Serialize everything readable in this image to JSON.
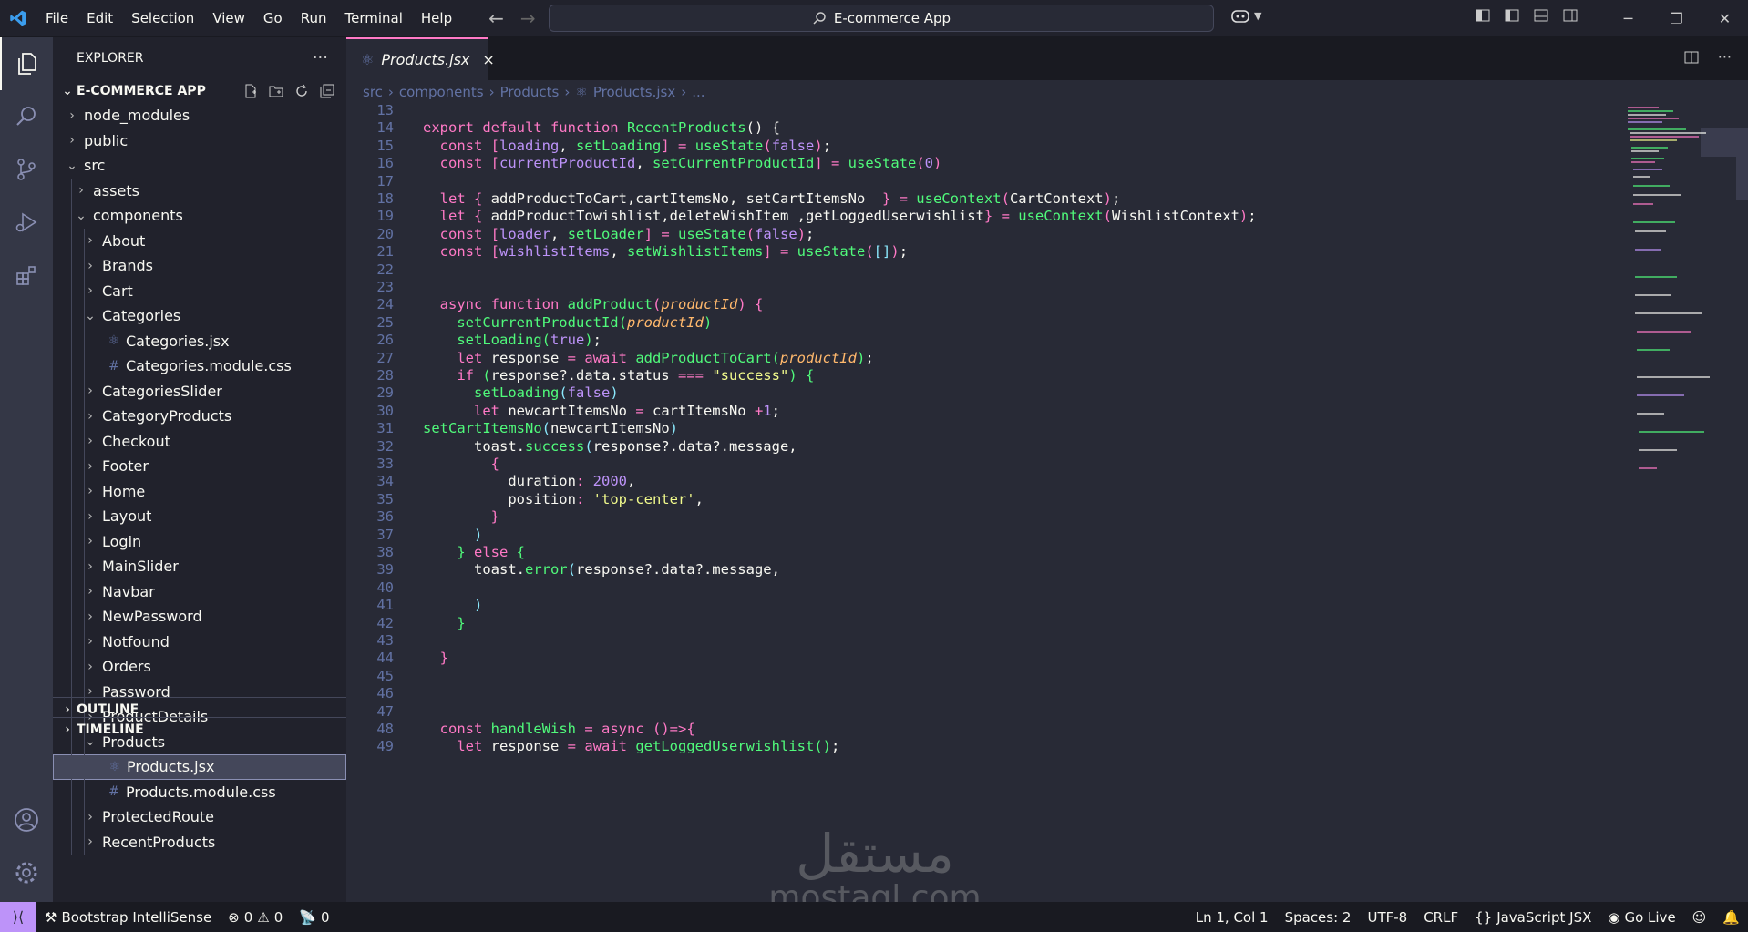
{
  "menu": [
    "File",
    "Edit",
    "Selection",
    "View",
    "Go",
    "Run",
    "Terminal",
    "Help"
  ],
  "command_center": "E-commerce App",
  "explorer": {
    "title": "EXPLORER",
    "root": "E-COMMERCE APP",
    "tree": [
      {
        "label": "node_modules",
        "type": "folder",
        "expanded": false,
        "depth": 0
      },
      {
        "label": "public",
        "type": "folder",
        "expanded": false,
        "depth": 0
      },
      {
        "label": "src",
        "type": "folder",
        "expanded": true,
        "depth": 0
      },
      {
        "label": "assets",
        "type": "folder",
        "expanded": false,
        "depth": 1
      },
      {
        "label": "components",
        "type": "folder",
        "expanded": true,
        "depth": 1
      },
      {
        "label": "About",
        "type": "folder",
        "expanded": false,
        "depth": 2
      },
      {
        "label": "Brands",
        "type": "folder",
        "expanded": false,
        "depth": 2
      },
      {
        "label": "Cart",
        "type": "folder",
        "expanded": false,
        "depth": 2
      },
      {
        "label": "Categories",
        "type": "folder",
        "expanded": true,
        "depth": 2
      },
      {
        "label": "Categories.jsx",
        "type": "jsx",
        "depth": 3
      },
      {
        "label": "Categories.module.css",
        "type": "css",
        "depth": 3
      },
      {
        "label": "CategoriesSlider",
        "type": "folder",
        "expanded": false,
        "depth": 2
      },
      {
        "label": "CategoryProducts",
        "type": "folder",
        "expanded": false,
        "depth": 2
      },
      {
        "label": "Checkout",
        "type": "folder",
        "expanded": false,
        "depth": 2
      },
      {
        "label": "Footer",
        "type": "folder",
        "expanded": false,
        "depth": 2
      },
      {
        "label": "Home",
        "type": "folder",
        "expanded": false,
        "depth": 2
      },
      {
        "label": "Layout",
        "type": "folder",
        "expanded": false,
        "depth": 2
      },
      {
        "label": "Login",
        "type": "folder",
        "expanded": false,
        "depth": 2
      },
      {
        "label": "MainSlider",
        "type": "folder",
        "expanded": false,
        "depth": 2
      },
      {
        "label": "Navbar",
        "type": "folder",
        "expanded": false,
        "depth": 2
      },
      {
        "label": "NewPassword",
        "type": "folder",
        "expanded": false,
        "depth": 2
      },
      {
        "label": "Notfound",
        "type": "folder",
        "expanded": false,
        "depth": 2
      },
      {
        "label": "Orders",
        "type": "folder",
        "expanded": false,
        "depth": 2
      },
      {
        "label": "Password",
        "type": "folder",
        "expanded": false,
        "depth": 2
      },
      {
        "label": "ProductDetails",
        "type": "folder",
        "expanded": false,
        "depth": 2
      },
      {
        "label": "Products",
        "type": "folder",
        "expanded": true,
        "depth": 2
      },
      {
        "label": "Products.jsx",
        "type": "jsx",
        "depth": 3,
        "selected": true
      },
      {
        "label": "Products.module.css",
        "type": "css",
        "depth": 3
      },
      {
        "label": "ProtectedRoute",
        "type": "folder",
        "expanded": false,
        "depth": 2
      },
      {
        "label": "RecentProducts",
        "type": "folder",
        "expanded": false,
        "depth": 2
      }
    ],
    "outline": "OUTLINE",
    "timeline": "TIMELINE"
  },
  "tab": {
    "label": "Products.jsx",
    "close": "×"
  },
  "breadcrumb": [
    "src",
    "components",
    "Products",
    "Products.jsx",
    "..."
  ],
  "code": [
    {
      "n": "13",
      "t": []
    },
    {
      "n": "14",
      "t": [
        [
          "k",
          "export default function "
        ],
        [
          "f",
          "RecentProducts"
        ],
        [
          "",
          "() {"
        ]
      ]
    },
    {
      "n": "15",
      "t": [
        [
          "",
          "  "
        ],
        [
          "k",
          "const "
        ],
        [
          "b1",
          "["
        ],
        [
          "v",
          "loading"
        ],
        [
          "",
          ", "
        ],
        [
          "f",
          "setLoading"
        ],
        [
          "b1",
          "]"
        ],
        [
          "k",
          " = "
        ],
        [
          "f",
          "useState"
        ],
        [
          "b1",
          "("
        ],
        [
          "v",
          "false"
        ],
        [
          "b1",
          ")"
        ],
        [
          "",
          ";"
        ]
      ]
    },
    {
      "n": "16",
      "t": [
        [
          "",
          "  "
        ],
        [
          "k",
          "const "
        ],
        [
          "b1",
          "["
        ],
        [
          "v",
          "currentProductId"
        ],
        [
          "",
          ", "
        ],
        [
          "f",
          "setCurrentProductId"
        ],
        [
          "b1",
          "]"
        ],
        [
          "k",
          " = "
        ],
        [
          "f",
          "useState"
        ],
        [
          "b1",
          "("
        ],
        [
          "v",
          "0"
        ],
        [
          "b1",
          ")"
        ]
      ]
    },
    {
      "n": "17",
      "t": []
    },
    {
      "n": "18",
      "t": [
        [
          "",
          "  "
        ],
        [
          "k",
          "let "
        ],
        [
          "b1",
          "{ "
        ],
        [
          "",
          "addProductToCart,cartItemsNo, setCartItemsNo  "
        ],
        [
          "b1",
          "}"
        ],
        [
          "k",
          " = "
        ],
        [
          "f",
          "useContext"
        ],
        [
          "b1",
          "("
        ],
        [
          "",
          "CartContext"
        ],
        [
          "b1",
          ")"
        ],
        [
          "",
          ";"
        ]
      ]
    },
    {
      "n": "19",
      "t": [
        [
          "",
          "  "
        ],
        [
          "k",
          "let "
        ],
        [
          "b1",
          "{ "
        ],
        [
          "",
          "addProductTowishlist,deleteWishItem ,getLoggedUserwishlist"
        ],
        [
          "b1",
          "}"
        ],
        [
          "k",
          " = "
        ],
        [
          "f",
          "useContext"
        ],
        [
          "b1",
          "("
        ],
        [
          "",
          "WishlistContext"
        ],
        [
          "b1",
          ")"
        ],
        [
          "",
          ";"
        ]
      ]
    },
    {
      "n": "20",
      "t": [
        [
          "",
          "  "
        ],
        [
          "k",
          "const "
        ],
        [
          "b1",
          "["
        ],
        [
          "v",
          "loader"
        ],
        [
          "",
          ", "
        ],
        [
          "f",
          "setLoader"
        ],
        [
          "b1",
          "]"
        ],
        [
          "k",
          " = "
        ],
        [
          "f",
          "useState"
        ],
        [
          "b1",
          "("
        ],
        [
          "v",
          "false"
        ],
        [
          "b1",
          ")"
        ],
        [
          "",
          ";"
        ]
      ]
    },
    {
      "n": "21",
      "t": [
        [
          "",
          "  "
        ],
        [
          "k",
          "const "
        ],
        [
          "b1",
          "["
        ],
        [
          "v",
          "wishlistItems"
        ],
        [
          "",
          ", "
        ],
        [
          "f",
          "setWishlistItems"
        ],
        [
          "b1",
          "]"
        ],
        [
          "k",
          " = "
        ],
        [
          "f",
          "useState"
        ],
        [
          "b1",
          "("
        ],
        [
          "b3",
          "[]"
        ],
        [
          "b1",
          ")"
        ],
        [
          "",
          ";"
        ]
      ]
    },
    {
      "n": "22",
      "t": []
    },
    {
      "n": "23",
      "t": []
    },
    {
      "n": "24",
      "t": [
        [
          "",
          "  "
        ],
        [
          "k",
          "async function "
        ],
        [
          "f",
          "addProduct"
        ],
        [
          "b1",
          "("
        ],
        [
          "p",
          "productId"
        ],
        [
          "b1",
          ")"
        ],
        [
          "",
          ""
        ],
        [
          "b1",
          " {"
        ]
      ]
    },
    {
      "n": "25",
      "t": [
        [
          "",
          "    "
        ],
        [
          "f",
          "setCurrentProductId"
        ],
        [
          "b2",
          "("
        ],
        [
          "p",
          "productId"
        ],
        [
          "b2",
          ")"
        ]
      ]
    },
    {
      "n": "26",
      "t": [
        [
          "",
          "    "
        ],
        [
          "f",
          "setLoading"
        ],
        [
          "b2",
          "("
        ],
        [
          "v",
          "true"
        ],
        [
          "b2",
          ")"
        ],
        [
          "",
          ";"
        ]
      ]
    },
    {
      "n": "27",
      "t": [
        [
          "",
          "    "
        ],
        [
          "k",
          "let "
        ],
        [
          "",
          "response "
        ],
        [
          "k",
          "= await "
        ],
        [
          "f",
          "addProductToCart"
        ],
        [
          "b2",
          "("
        ],
        [
          "p",
          "productId"
        ],
        [
          "b2",
          ")"
        ],
        [
          "",
          ";"
        ]
      ]
    },
    {
      "n": "28",
      "t": [
        [
          "",
          "    "
        ],
        [
          "k",
          "if "
        ],
        [
          "b2",
          "("
        ],
        [
          "",
          "response?.data.status "
        ],
        [
          "k",
          "=== "
        ],
        [
          "s",
          "\"success\""
        ],
        [
          "b2",
          ")"
        ],
        [
          "b2",
          " {"
        ]
      ]
    },
    {
      "n": "29",
      "t": [
        [
          "",
          "      "
        ],
        [
          "f",
          "setLoading"
        ],
        [
          "b3",
          "("
        ],
        [
          "v",
          "false"
        ],
        [
          "b3",
          ")"
        ]
      ]
    },
    {
      "n": "30",
      "t": [
        [
          "",
          "      "
        ],
        [
          "k",
          "let "
        ],
        [
          "",
          "newcartItemsNo "
        ],
        [
          "k",
          "= "
        ],
        [
          "",
          "cartItemsNo "
        ],
        [
          "k",
          "+"
        ],
        [
          "v",
          "1"
        ],
        [
          "",
          ";"
        ]
      ]
    },
    {
      "n": "31",
      "t": [
        [
          "f",
          "setCartItemsNo"
        ],
        [
          "b3",
          "("
        ],
        [
          "",
          "newcartItemsNo"
        ],
        [
          "b3",
          ")"
        ]
      ]
    },
    {
      "n": "32",
      "t": [
        [
          "",
          "      toast."
        ],
        [
          "f",
          "success"
        ],
        [
          "b3",
          "("
        ],
        [
          "",
          "response?.data?.message,"
        ]
      ]
    },
    {
      "n": "33",
      "t": [
        [
          "",
          "        "
        ],
        [
          "b1",
          "{"
        ]
      ]
    },
    {
      "n": "34",
      "t": [
        [
          "",
          "          duration"
        ],
        [
          "k",
          ": "
        ],
        [
          "v",
          "2000"
        ],
        [
          "",
          ","
        ]
      ]
    },
    {
      "n": "35",
      "t": [
        [
          "",
          "          position"
        ],
        [
          "k",
          ": "
        ],
        [
          "s",
          "'top-center'"
        ],
        [
          "",
          ","
        ]
      ]
    },
    {
      "n": "36",
      "t": [
        [
          "",
          "        "
        ],
        [
          "b1",
          "}"
        ]
      ]
    },
    {
      "n": "37",
      "t": [
        [
          "",
          "      "
        ],
        [
          "b3",
          ")"
        ]
      ]
    },
    {
      "n": "38",
      "t": [
        [
          "",
          "    "
        ],
        [
          "b2",
          "}"
        ],
        [
          "k",
          " else "
        ],
        [
          "b2",
          "{"
        ]
      ]
    },
    {
      "n": "39",
      "t": [
        [
          "",
          "      toast."
        ],
        [
          "f",
          "error"
        ],
        [
          "b3",
          "("
        ],
        [
          "",
          "response?.data?.message,"
        ]
      ]
    },
    {
      "n": "40",
      "t": []
    },
    {
      "n": "41",
      "t": [
        [
          "",
          "      "
        ],
        [
          "b3",
          ")"
        ]
      ]
    },
    {
      "n": "42",
      "t": [
        [
          "",
          "    "
        ],
        [
          "b2",
          "}"
        ]
      ]
    },
    {
      "n": "43",
      "t": []
    },
    {
      "n": "44",
      "t": [
        [
          "",
          "  "
        ],
        [
          "b1",
          "}"
        ]
      ]
    },
    {
      "n": "45",
      "t": []
    },
    {
      "n": "46",
      "t": []
    },
    {
      "n": "47",
      "t": []
    },
    {
      "n": "48",
      "t": [
        [
          "",
          "  "
        ],
        [
          "k",
          "const "
        ],
        [
          "f",
          "handleWish "
        ],
        [
          "k",
          "= async "
        ],
        [
          "b1",
          "()"
        ],
        [
          "k",
          "=>"
        ],
        [
          "b1",
          "{"
        ]
      ]
    },
    {
      "n": "49",
      "t": [
        [
          "",
          "    "
        ],
        [
          "k",
          "let "
        ],
        [
          "",
          "response "
        ],
        [
          "k",
          "= await "
        ],
        [
          "f",
          "getLoggedUserwishlist"
        ],
        [
          "b2",
          "()"
        ],
        [
          "",
          ";"
        ]
      ]
    }
  ],
  "watermark": {
    "line1": "مستقل",
    "line2": "mostaql.com"
  },
  "status": {
    "intellisense": "Bootstrap IntelliSense",
    "errors": "0",
    "warnings": "0",
    "ports": "0",
    "position": "Ln 1, Col 1",
    "spaces": "Spaces: 2",
    "encoding": "UTF-8",
    "eol": "CRLF",
    "language": "JavaScript JSX",
    "golive": "Go Live"
  },
  "colors": {
    "accent": "#bd93f9",
    "pink": "#ff79c6",
    "green": "#50fa7b",
    "bg": "#282a36"
  }
}
